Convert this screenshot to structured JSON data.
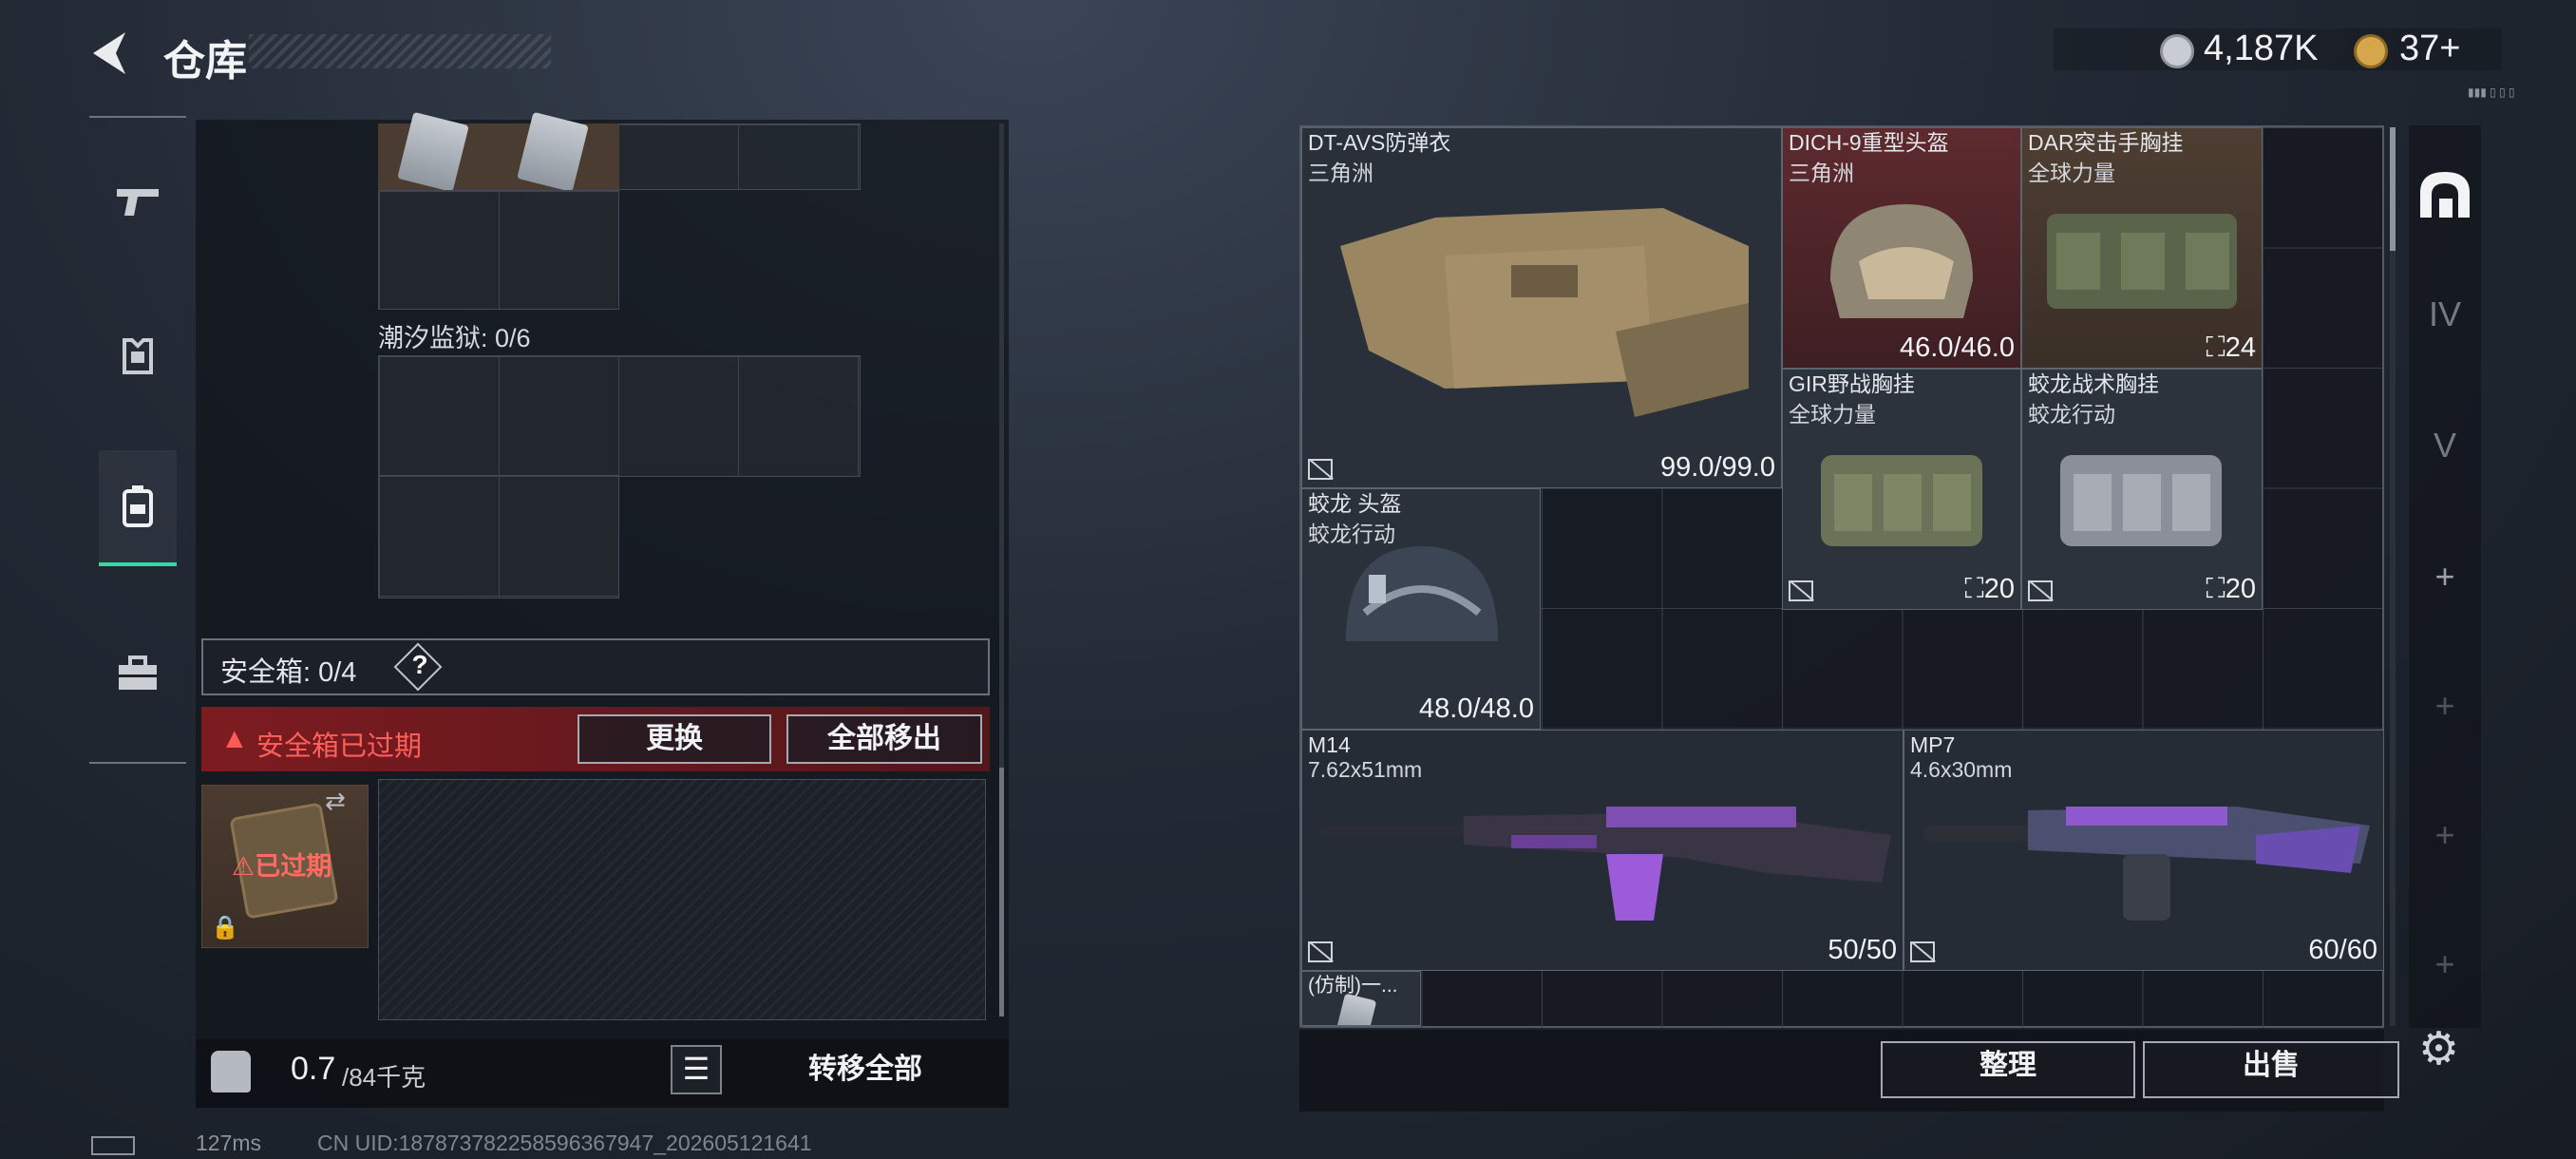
{
  "header": {
    "title": "仓库",
    "currency": [
      {
        "icon": "silver-coin-icon",
        "value": "4,187K"
      },
      {
        "icon": "gold-coin-icon",
        "value": "37+"
      }
    ],
    "small_label": "▮▮▮ ▯ ▯ ▯"
  },
  "left_nav": [
    {
      "name": "weapon-tab",
      "icon": "pistol-icon"
    },
    {
      "name": "gear-tab",
      "icon": "armor-icon"
    },
    {
      "name": "backpack-tab",
      "icon": "backpack-icon",
      "active": true
    },
    {
      "name": "toolbox-tab",
      "icon": "toolbox-icon"
    }
  ],
  "containers": {
    "tide_prison_label": "潮汐监狱: 0/6"
  },
  "safe_box": {
    "label": "安全箱: 0/4",
    "help": "?",
    "expired_warning": "安全箱已过期",
    "replace_label": "更换",
    "move_all_label": "全部移出",
    "item_status": "已过期"
  },
  "footer": {
    "weight_value": "0.7",
    "weight_unit": "/84千克",
    "transfer_all_label": "转移全部",
    "ping": "127ms",
    "uid": "CN UID:187873782258596367947_202605121641"
  },
  "stash": {
    "items": [
      {
        "name": "DT-AVS防弹衣",
        "sub": "三角洲",
        "value": "99.0/99.0",
        "kind": "armor"
      },
      {
        "name": "DICH-9重型头盔",
        "sub": "三角洲",
        "value": "46.0/46.0",
        "kind": "helmet-red"
      },
      {
        "name": "DAR突击手胸挂",
        "sub": "全球力量",
        "value": "24",
        "kind": "rig"
      },
      {
        "name": "GIR野战胸挂",
        "sub": "全球力量",
        "value": "20",
        "kind": "rig"
      },
      {
        "name": "蛟龙战术胸挂",
        "sub": "蛟龙行动",
        "value": "20",
        "kind": "rig"
      },
      {
        "name": "蛟龙 头盔",
        "sub": "蛟龙行动",
        "value": "48.0/48.0",
        "kind": "helmet"
      },
      {
        "name": "M14",
        "sub": "7.62x51mm",
        "value": "50/50",
        "kind": "rifle"
      },
      {
        "name": "MP7",
        "sub": "4.6x30mm",
        "value": "60/60",
        "kind": "smg"
      },
      {
        "name": "(仿制)一...",
        "sub": "",
        "value": "",
        "kind": "card"
      }
    ],
    "sort_label": "整理",
    "sell_label": "出售"
  },
  "right_tabs": [
    {
      "icon": "home-arch-icon",
      "active": true
    },
    {
      "icon": "stash-iv-icon",
      "label": "IV"
    },
    {
      "icon": "stash-v-icon",
      "label": "V"
    },
    {
      "icon": "plus-icon",
      "label": "+"
    },
    {
      "icon": "plus-icon",
      "label": "+"
    },
    {
      "icon": "plus-icon",
      "label": "+"
    },
    {
      "icon": "plus-icon",
      "label": "+"
    }
  ],
  "colors": {
    "accent": "#37d8a4",
    "warning": "#ff5f59",
    "helmet_bg": "#5a2a2c",
    "rig_bg": "#4a3a2e"
  }
}
